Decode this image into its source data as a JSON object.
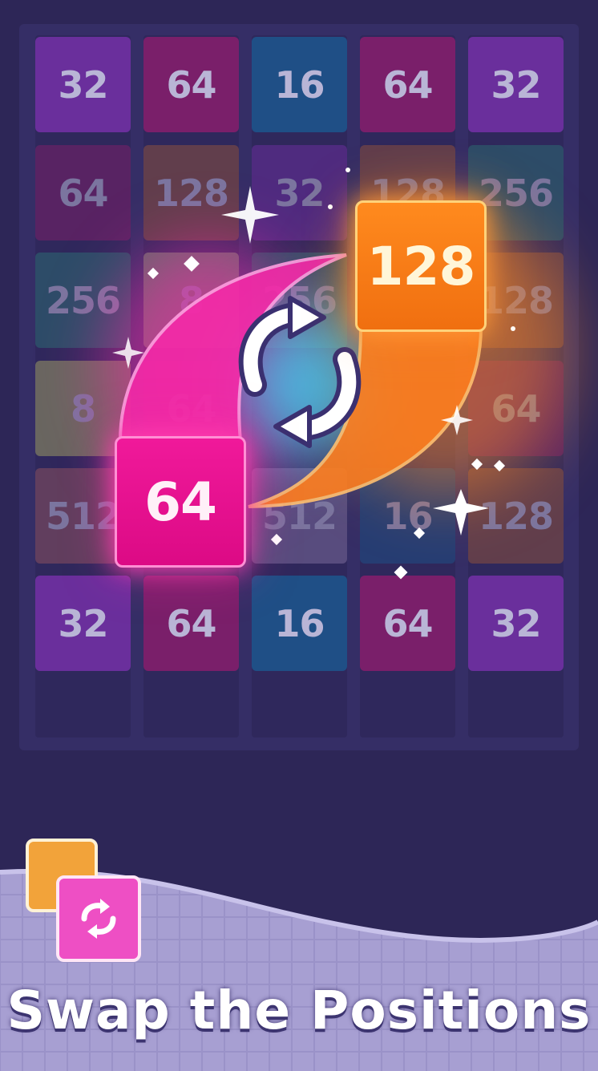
{
  "board": {
    "rows": [
      [
        "32",
        "64",
        "16",
        "64",
        "32"
      ],
      [
        "64",
        "128",
        "32",
        "128",
        "256"
      ],
      [
        "256",
        "8",
        "256",
        "",
        "128"
      ],
      [
        "8",
        "64",
        "",
        "",
        "64"
      ],
      [
        "512",
        "",
        "512",
        "16",
        "128"
      ],
      [
        "32",
        "64",
        "16",
        "64",
        "32"
      ]
    ],
    "colors": [
      [
        "#6a2f9c",
        "#7a1f6a",
        "#1f4f86",
        "#7a1f6a",
        "#6a2f9c"
      ],
      [
        "#7a1f6a",
        "#8a5040",
        "#6a2f9c",
        "#8a5040",
        "#2c6a72"
      ],
      [
        "#2c6a72",
        "#8a9a7a",
        "#2c6a72",
        "#2f285c",
        "#8a5040"
      ],
      [
        "#9a9a64",
        "#7a1f6a",
        "#2f285c",
        "#2f285c",
        "#7a1f6a"
      ],
      [
        "#8a5060",
        "#2f285c",
        "#7a6a9a",
        "#1f4f86",
        "#8a5040"
      ],
      [
        "#6a2f9c",
        "#7a1f6a",
        "#1f4f86",
        "#7a1f6a",
        "#6a2f9c"
      ]
    ]
  },
  "swap": {
    "tile_a": "128",
    "tile_b": "64",
    "tile_a_color": "#f07418",
    "tile_b_color": "#e2108a",
    "icon": "swap-arrows-icon"
  },
  "caption": "Swap the Positions",
  "badge_icon": "swap-positions-icon"
}
